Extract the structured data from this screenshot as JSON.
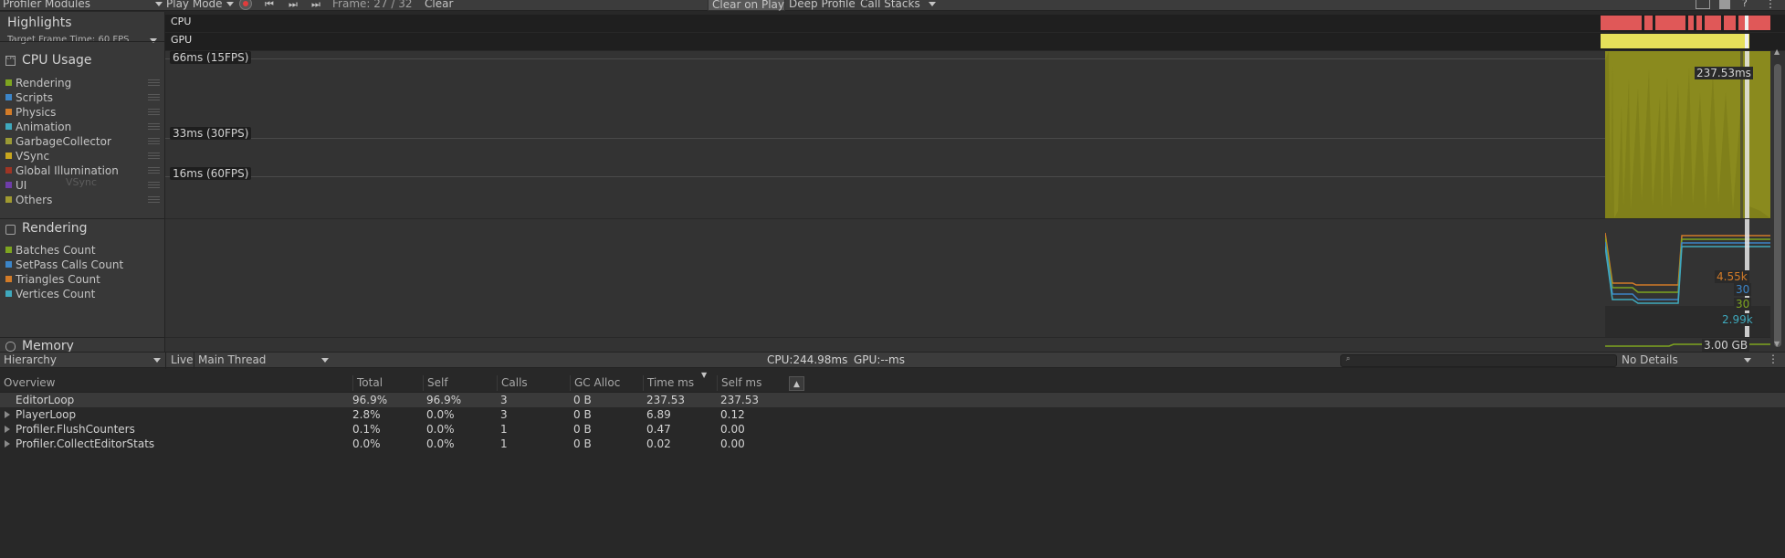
{
  "toolbar": {
    "modules_label": "Profiler Modules",
    "play_mode_label": "Play Mode",
    "frame_label": "Frame: 27 / 32",
    "clear_label": "Clear",
    "clear_on_play_label": "Clear on Play",
    "deep_profile_label": "Deep Profile",
    "call_stacks_label": "Call Stacks"
  },
  "highlights": {
    "title": "Highlights",
    "target_frame": "Target Frame Time: 60 FPS",
    "cpu_label": "CPU",
    "gpu_label": "GPU"
  },
  "cpu_module": {
    "title": "CPU Usage",
    "icon_text": "CPU",
    "legend": [
      {
        "label": "Rendering",
        "color": "#7ea520"
      },
      {
        "label": "Scripts",
        "color": "#3c85c8"
      },
      {
        "label": "Physics",
        "color": "#d27b28"
      },
      {
        "label": "Animation",
        "color": "#3fa9bd"
      },
      {
        "label": "GarbageCollector",
        "color": "#9a9a35"
      },
      {
        "label": "VSync",
        "color": "#c8a61e"
      },
      {
        "label": "Global Illumination",
        "color": "#9e3524"
      },
      {
        "label": "UI",
        "color": "#6e3da8"
      },
      {
        "label": "Others",
        "color": "#a09a30"
      }
    ],
    "ghost_text": "VSync",
    "fps_66": "66ms (15FPS)",
    "fps_33": "33ms (30FPS)",
    "fps_16": "16ms (60FPS)",
    "value_label": "237.53ms"
  },
  "rendering_module": {
    "title": "Rendering",
    "legend": [
      {
        "label": "Batches Count",
        "color": "#7ea520"
      },
      {
        "label": "SetPass Calls Count",
        "color": "#3c85c8"
      },
      {
        "label": "Triangles Count",
        "color": "#d27b28"
      },
      {
        "label": "Vertices Count",
        "color": "#3fa9bd"
      }
    ],
    "values": [
      "4.55k",
      "30",
      "30",
      "2.99k"
    ]
  },
  "memory_module": {
    "title": "Memory",
    "value": "3.00 GB"
  },
  "bottom_toolbar": {
    "view_label": "Hierarchy",
    "live_label": "Live",
    "thread_label": "Main Thread",
    "cpu_stat": "CPU:244.98ms",
    "gpu_stat": "GPU:--ms",
    "details_label": "No Details"
  },
  "table": {
    "columns": [
      "Overview",
      "Total",
      "Self",
      "Calls",
      "GC Alloc",
      "Time ms",
      "Self ms"
    ],
    "rows": [
      {
        "name": "EditorLoop",
        "expandable": false,
        "total": "96.9%",
        "self": "96.9%",
        "calls": "3",
        "gc": "0 B",
        "time": "237.53",
        "self_ms": "237.53"
      },
      {
        "name": "PlayerLoop",
        "expandable": true,
        "total": "2.8%",
        "self": "0.0%",
        "calls": "3",
        "gc": "0 B",
        "time": "6.89",
        "self_ms": "0.12"
      },
      {
        "name": "Profiler.FlushCounters",
        "expandable": true,
        "total": "0.1%",
        "self": "0.0%",
        "calls": "1",
        "gc": "0 B",
        "time": "0.47",
        "self_ms": "0.00"
      },
      {
        "name": "Profiler.CollectEditorStats",
        "expandable": true,
        "total": "0.0%",
        "self": "0.0%",
        "calls": "1",
        "gc": "0 B",
        "time": "0.02",
        "self_ms": "0.00"
      }
    ]
  }
}
